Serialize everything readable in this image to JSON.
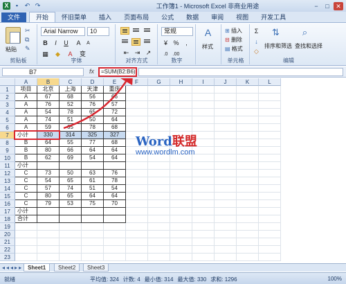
{
  "window": {
    "title": "工作簿1 - Microsoft Excel 非商业用途",
    "controls": [
      "−",
      "□",
      "✕"
    ]
  },
  "tabs": [
    "文件",
    "开始",
    "怀旧菜单",
    "插入",
    "页面布局",
    "公式",
    "数据",
    "审阅",
    "视图",
    "开发工具"
  ],
  "ribbon": {
    "paste": "粘贴",
    "font_name": "Arial Narrow",
    "font_size": "10",
    "number_format": "常规",
    "insert": "插入",
    "delete": "删除",
    "format": "格式",
    "style": "样式",
    "sort_filter": "排序和筛选",
    "find_select": "查找和选择",
    "groups": [
      "剪贴板",
      "字体",
      "对齐方式",
      "数字",
      "单元格",
      "编辑"
    ]
  },
  "formula_bar": {
    "name_box": "B7",
    "fx": "fx",
    "formula": "=SUM(B2:B6)"
  },
  "columns": [
    "A",
    "B",
    "C",
    "D",
    "E",
    "F",
    "G",
    "H",
    "I",
    "J",
    "K",
    "L"
  ],
  "rows": [
    [
      "项目",
      "北京",
      "上海",
      "天津",
      "重庆"
    ],
    [
      "A",
      "67",
      "68",
      "56",
      "66"
    ],
    [
      "A",
      "76",
      "52",
      "76",
      "57"
    ],
    [
      "A",
      "54",
      "78",
      "65",
      "72"
    ],
    [
      "A",
      "74",
      "51",
      "50",
      "64"
    ],
    [
      "A",
      "59",
      "65",
      "78",
      "68"
    ],
    [
      "小计",
      "330",
      "314",
      "325",
      "327"
    ],
    [
      "B",
      "64",
      "55",
      "77",
      "68"
    ],
    [
      "B",
      "80",
      "66",
      "64",
      "64"
    ],
    [
      "B",
      "62",
      "69",
      "54",
      "64"
    ],
    [
      "小计",
      "",
      "",
      "",
      ""
    ],
    [
      "C",
      "73",
      "50",
      "63",
      "76"
    ],
    [
      "C",
      "54",
      "65",
      "61",
      "78"
    ],
    [
      "C",
      "57",
      "74",
      "51",
      "54"
    ],
    [
      "C",
      "80",
      "65",
      "64",
      "64"
    ],
    [
      "C",
      "79",
      "53",
      "75",
      "70"
    ],
    [
      "小计",
      "",
      "",
      "",
      ""
    ],
    [
      "合计",
      "",
      "",
      "",
      ""
    ],
    [
      "",
      "",
      "",
      "",
      ""
    ],
    [
      "",
      "",
      "",
      "",
      ""
    ],
    [
      "",
      "",
      "",
      "",
      ""
    ],
    [
      "",
      "",
      "",
      "",
      ""
    ],
    [
      "",
      "",
      "",
      "",
      ""
    ]
  ],
  "row_numbers": [
    "1",
    "2",
    "3",
    "4",
    "5",
    "6",
    "7",
    "8",
    "9",
    "10",
    "11",
    "12",
    "13",
    "14",
    "15",
    "16",
    "17",
    "18",
    "19",
    "20",
    "21",
    "22",
    "23"
  ],
  "watermark": {
    "brand_latin": "Word",
    "brand_cn": "联盟",
    "url": "www.wordlm.com"
  },
  "sheets": [
    "Sheet1",
    "Sheet2",
    "Sheet3"
  ],
  "status": {
    "mode": "就绪",
    "average": "平均值: 324",
    "count": "计数: 4",
    "min": "最小值: 314",
    "max": "最大值: 330",
    "sum": "求和: 1296",
    "zoom": "100%"
  },
  "colors": {
    "selection": "#c7daf0",
    "header_selected": "#f7d98e",
    "annotation": "#d8262f"
  }
}
